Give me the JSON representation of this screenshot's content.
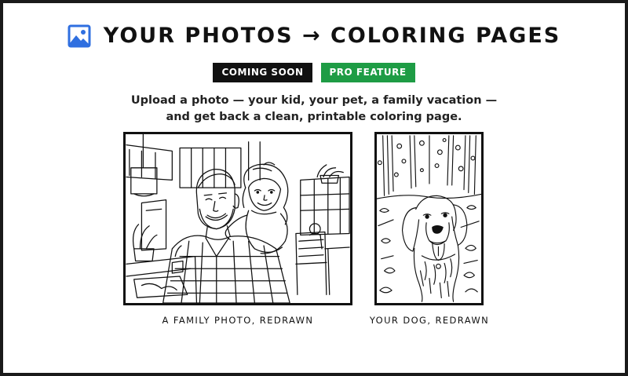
{
  "header": {
    "icon": "image-icon",
    "title": "YOUR PHOTOS → COLORING PAGES"
  },
  "badges": {
    "coming_soon": "COMING SOON",
    "pro_feature": "PRO FEATURE"
  },
  "colors": {
    "accent_blue": "#2f6fe0",
    "pro_green": "#1e9c45",
    "badge_dark": "#111111"
  },
  "intro": {
    "line1": "Upload a photo — your kid, your pet, a family vacation —",
    "line2": "and get back a clean, printable coloring page."
  },
  "examples": [
    {
      "caption": "A FAMILY PHOTO, REDRAWN",
      "illustration": "father-and-daughter-coloring-page"
    },
    {
      "caption": "YOUR DOG, REDRAWN",
      "illustration": "dog-coloring-page"
    }
  ]
}
